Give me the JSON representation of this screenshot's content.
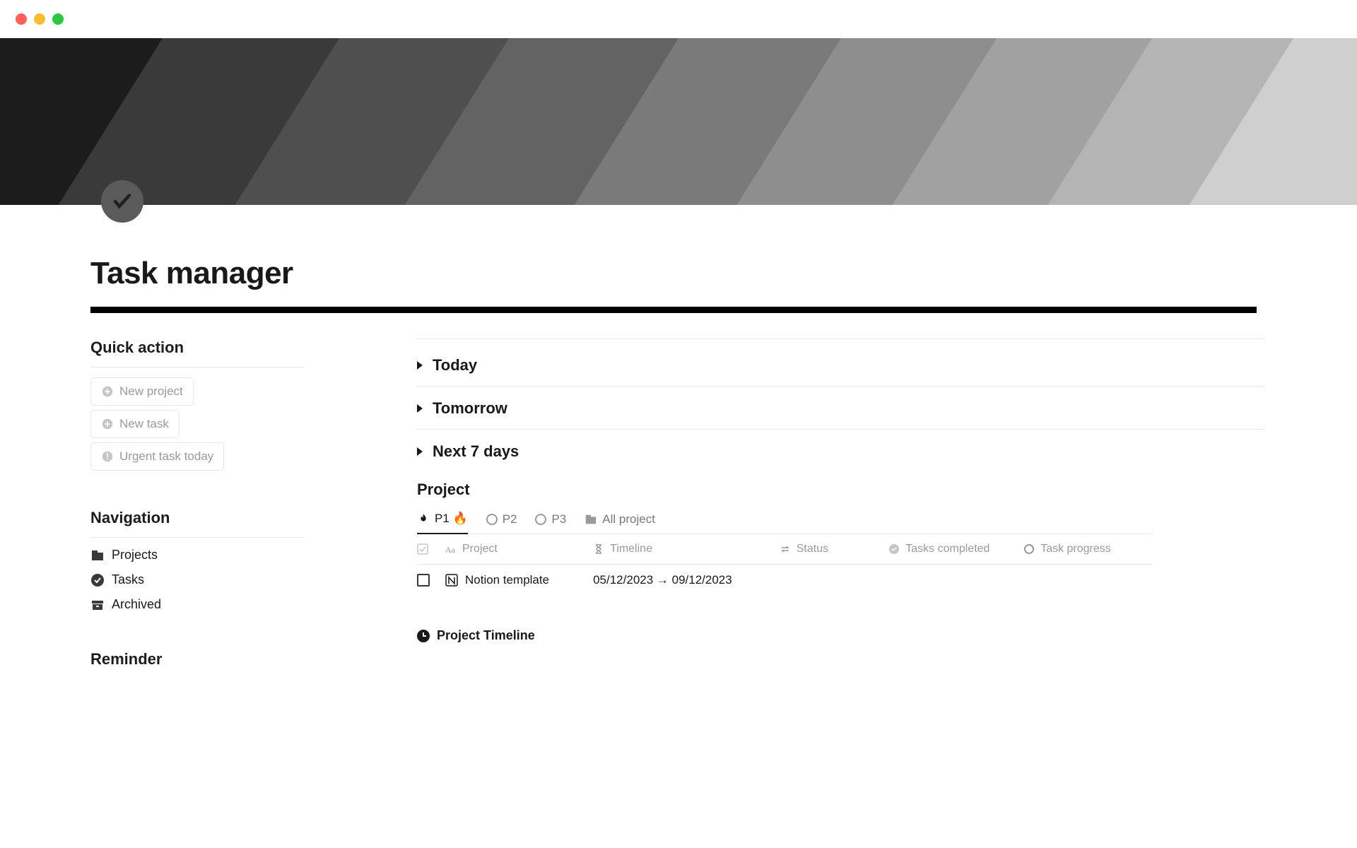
{
  "page": {
    "title": "Task manager"
  },
  "sidebar": {
    "quick_action": {
      "heading": "Quick action",
      "buttons": [
        {
          "label": "New project"
        },
        {
          "label": "New task"
        },
        {
          "label": "Urgent task today"
        }
      ]
    },
    "navigation": {
      "heading": "Navigation",
      "items": [
        {
          "label": "Projects"
        },
        {
          "label": "Tasks"
        },
        {
          "label": "Archived"
        }
      ]
    },
    "reminder": {
      "heading": "Reminder"
    }
  },
  "main": {
    "toggles": [
      {
        "label": "Today"
      },
      {
        "label": "Tomorrow"
      },
      {
        "label": "Next 7 days"
      }
    ],
    "project": {
      "heading": "Project",
      "tabs": [
        {
          "label": "P1 🔥"
        },
        {
          "label": "P2"
        },
        {
          "label": "P3"
        },
        {
          "label": "All project"
        }
      ],
      "columns": {
        "project": "Project",
        "timeline": "Timeline",
        "status": "Status",
        "completed": "Tasks completed",
        "progress": "Task progress"
      },
      "rows": [
        {
          "name": "Notion template",
          "timeline": "05/12/2023 → 09/12/2023"
        }
      ],
      "timeline_heading": "Project Timeline"
    }
  }
}
